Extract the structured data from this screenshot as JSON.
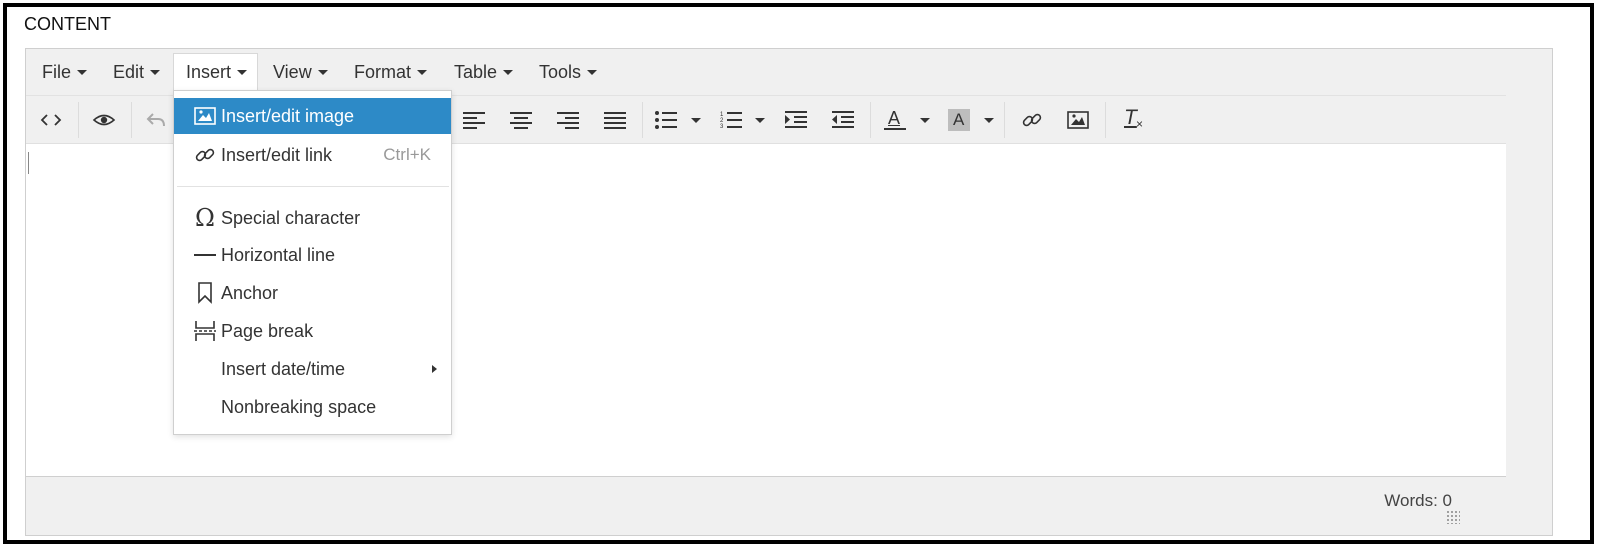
{
  "section_label": "CONTENT",
  "menubar": {
    "items": [
      {
        "label": "File"
      },
      {
        "label": "Edit"
      },
      {
        "label": "Insert"
      },
      {
        "label": "View"
      },
      {
        "label": "Format"
      },
      {
        "label": "Table"
      },
      {
        "label": "Tools"
      }
    ]
  },
  "toolbar": {
    "buttons": [
      "source-code",
      "preview",
      "undo",
      "align-left",
      "align-center",
      "align-right",
      "align-justify",
      "bullet-list",
      "numbered-list",
      "indent",
      "outdent",
      "text-color",
      "background-color",
      "link",
      "image",
      "clear-formatting"
    ],
    "text_color_glyph": "A",
    "bg_color_glyph": "A",
    "clear_format_glyph": "T"
  },
  "insert_menu": {
    "items": [
      {
        "label": "Insert/edit image",
        "icon": "image-icon",
        "active": true
      },
      {
        "label": "Insert/edit link",
        "icon": "link-icon",
        "shortcut": "Ctrl+K"
      },
      {
        "label": "Special character",
        "icon": "omega-icon"
      },
      {
        "label": "Horizontal line",
        "icon": "horizontal-line-icon"
      },
      {
        "label": "Anchor",
        "icon": "bookmark-icon"
      },
      {
        "label": "Page break",
        "icon": "page-break-icon"
      },
      {
        "label": "Insert date/time",
        "submenu": true
      },
      {
        "label": "Nonbreaking space"
      }
    ]
  },
  "status": {
    "words": "Words: 0"
  },
  "colors": {
    "accent": "#2d8ac7",
    "chrome": "#f0f0f0",
    "border": "#cfcfcf"
  }
}
